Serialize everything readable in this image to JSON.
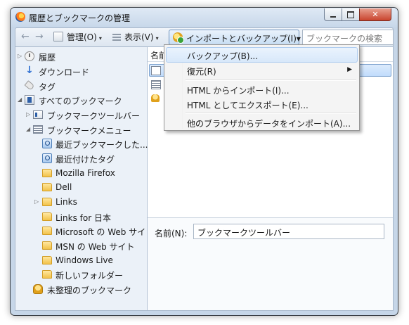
{
  "window": {
    "title": "履歴とブックマークの管理"
  },
  "titlebar_buttons": {
    "minimize": "",
    "maximize": "",
    "close": "✕"
  },
  "toolbar": {
    "back": "←",
    "forward": "→",
    "organize_label": "管理(O)",
    "view_label": "表示(V)",
    "import_label": "インポートとバックアップ(I)",
    "caret": "▾",
    "search_placeholder": "ブックマークの検索"
  },
  "sidebar": {
    "items": [
      {
        "label": "履歴",
        "icon": "history-icon",
        "expander": "▷"
      },
      {
        "label": "ダウンロード",
        "icon": "download-icon"
      },
      {
        "label": "タグ",
        "icon": "tag-icon"
      },
      {
        "label": "すべてのブックマーク",
        "icon": "all-bookmarks-icon",
        "expander": "◢"
      },
      {
        "label": "ブックマークツールバー",
        "icon": "bookmarks-toolbar-icon",
        "expander": "▷"
      },
      {
        "label": "ブックマークメニュー",
        "icon": "bookmarks-menu-icon",
        "expander": "◢"
      },
      {
        "label": "最近ブックマークした...",
        "icon": "smart-folder-icon"
      },
      {
        "label": "最近付けたタグ",
        "icon": "smart-folder-icon"
      },
      {
        "label": "Mozilla Firefox",
        "icon": "folder-icon"
      },
      {
        "label": "Dell",
        "icon": "folder-icon"
      },
      {
        "label": "Links",
        "icon": "folder-icon",
        "expander": "▷"
      },
      {
        "label": "Links for 日本",
        "icon": "folder-icon"
      },
      {
        "label": "Microsoft の Web サイト",
        "icon": "folder-icon"
      },
      {
        "label": "MSN の Web サイト",
        "icon": "folder-icon"
      },
      {
        "label": "Windows Live",
        "icon": "folder-icon"
      },
      {
        "label": "新しいフォルダー",
        "icon": "folder-icon"
      },
      {
        "label": "未整理のブックマーク",
        "icon": "unsorted-bookmarks-icon"
      }
    ]
  },
  "list": {
    "column_name": "名前"
  },
  "details": {
    "name_label": "名前(N):",
    "name_value": "ブックマークツールバー"
  },
  "menu": {
    "items": [
      {
        "label": "バックアップ(B)..."
      },
      {
        "label": "復元(R)",
        "arrow": "▶"
      },
      {
        "label": "HTML からインポート(I)..."
      },
      {
        "label": "HTML としてエクスポート(E)..."
      },
      {
        "label": "他のブラウザからデータをインポート(A)..."
      }
    ]
  },
  "colors": {
    "window_frame": "#c6d6e8",
    "sidebar_bg": "#ebf1f8",
    "selection": "#c1dcfc",
    "folder": "#f2c24a"
  }
}
